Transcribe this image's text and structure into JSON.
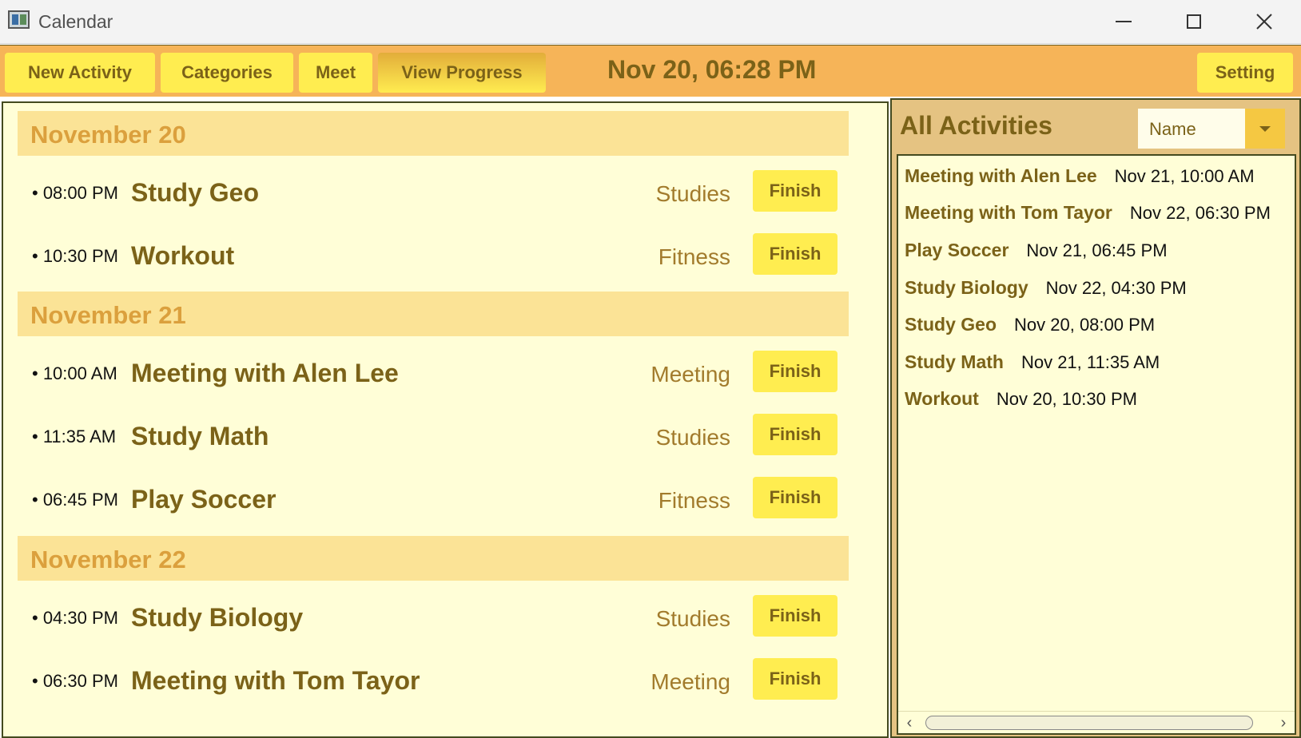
{
  "window": {
    "title": "Calendar"
  },
  "toolbar": {
    "new_activity": "New Activity",
    "categories": "Categories",
    "meet": "Meet",
    "view_progress": "View Progress",
    "clock": "Nov 20, 06:28 PM",
    "setting": "Setting"
  },
  "schedule": {
    "days": [
      {
        "label": "November 20",
        "activities": [
          {
            "time": "• 08:00 PM",
            "name": "Study Geo",
            "category": "Studies",
            "action": "Finish"
          },
          {
            "time": "• 10:30 PM",
            "name": "Workout",
            "category": "Fitness",
            "action": "Finish"
          }
        ]
      },
      {
        "label": "November 21",
        "activities": [
          {
            "time": "• 10:00 AM",
            "name": "Meeting with Alen Lee",
            "category": "Meeting",
            "action": "Finish"
          },
          {
            "time": "• 11:35 AM",
            "name": "Study Math",
            "category": "Studies",
            "action": "Finish"
          },
          {
            "time": "• 06:45 PM",
            "name": "Play Soccer",
            "category": "Fitness",
            "action": "Finish"
          }
        ]
      },
      {
        "label": "November 22",
        "activities": [
          {
            "time": "• 04:30 PM",
            "name": "Study Biology",
            "category": "Studies",
            "action": "Finish"
          },
          {
            "time": "• 06:30 PM",
            "name": "Meeting with Tom Tayor",
            "category": "Meeting",
            "action": "Finish"
          }
        ]
      }
    ]
  },
  "all_activities": {
    "title": "All Activities",
    "sort_value": "Name",
    "items": [
      {
        "name": "Meeting with Alen Lee",
        "date": "Nov 21, 10:00 AM"
      },
      {
        "name": "Meeting with Tom Tayor",
        "date": "Nov 22, 06:30 PM"
      },
      {
        "name": "Play Soccer",
        "date": "Nov 21, 06:45 PM"
      },
      {
        "name": "Study Biology",
        "date": "Nov 22, 04:30 PM"
      },
      {
        "name": "Study Geo",
        "date": "Nov 20, 08:00 PM"
      },
      {
        "name": "Study Math",
        "date": "Nov 21, 11:35 AM"
      },
      {
        "name": "Workout",
        "date": "Nov 20, 10:30 PM"
      }
    ]
  },
  "colors": {
    "toolbar_bg": "#f6b458",
    "button_bg": "#ffed50",
    "text_brown": "#7b6218",
    "day_header_bg": "#fbe396",
    "day_header_text": "#dba03d",
    "panel_bg": "#fffed7"
  }
}
